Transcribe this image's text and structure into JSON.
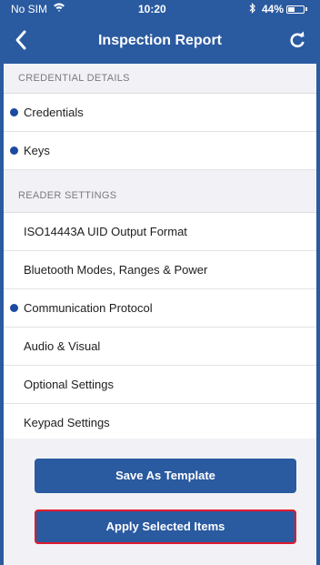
{
  "status_bar": {
    "carrier": "No SIM",
    "time": "10:20",
    "battery_percent": "44%",
    "battery_level": 0.44
  },
  "nav": {
    "title": "Inspection Report",
    "back_icon": "chevron-left-icon",
    "refresh_icon": "refresh-icon"
  },
  "sections": {
    "credential_details": {
      "header": "CREDENTIAL DETAILS",
      "items": [
        {
          "label": "Credentials",
          "marked": true
        },
        {
          "label": "Keys",
          "marked": true
        }
      ]
    },
    "reader_settings": {
      "header": "READER SETTINGS",
      "items": [
        {
          "label": "ISO14443A UID Output Format",
          "marked": false
        },
        {
          "label": "Bluetooth Modes, Ranges & Power",
          "marked": false
        },
        {
          "label": "Communication Protocol",
          "marked": true
        },
        {
          "label": "Audio & Visual",
          "marked": false
        },
        {
          "label": "Optional Settings",
          "marked": false
        },
        {
          "label": "Keypad Settings",
          "marked": false
        }
      ]
    }
  },
  "buttons": {
    "save_template": "Save As Template",
    "apply_selected": "Apply Selected Items"
  },
  "colors": {
    "brand": "#2a5aa0",
    "marker": "#1b4aa0",
    "highlight": "#e21a2c"
  }
}
